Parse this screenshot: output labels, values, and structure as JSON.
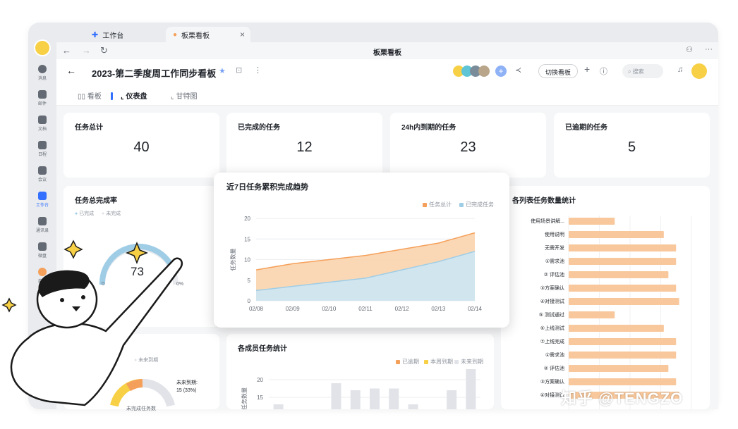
{
  "window": {
    "tabs": [
      {
        "label": "工作台"
      },
      {
        "label": "板栗看板"
      }
    ],
    "nav_title": "板栗看板"
  },
  "sidebar": {
    "items": [
      {
        "label": "消息"
      },
      {
        "label": "邮件"
      },
      {
        "label": "文档"
      },
      {
        "label": "日程"
      },
      {
        "label": "会议"
      },
      {
        "label": "工作台"
      },
      {
        "label": "通讯录"
      },
      {
        "label": "微盘"
      },
      {
        "label": "商店"
      }
    ]
  },
  "doc": {
    "title": "2023-第二季度周工作同步看板",
    "switch_label": "切换看板",
    "search_placeholder": "搜索",
    "view_tabs": [
      {
        "label": "看板"
      },
      {
        "label": "仪表盘"
      },
      {
        "label": "甘特图"
      }
    ]
  },
  "stats": [
    {
      "label": "任务总计",
      "value": "40"
    },
    {
      "label": "已完成的任务",
      "value": "12"
    },
    {
      "label": "24h内到期的任务",
      "value": "23"
    },
    {
      "label": "已逾期的任务",
      "value": "5"
    }
  ],
  "completion_card": {
    "title": "任务总完成率",
    "legend": [
      "已完成",
      "未完成"
    ],
    "value": "73",
    "gauge_left": "0",
    "gauge_right": "0%"
  },
  "list_card": {
    "title": "各列表任务数量统计"
  },
  "member_card": {
    "title": "各成员任务统计",
    "legend": [
      "已逾期",
      "本周到期",
      "未来到期"
    ]
  },
  "pie_card": {
    "legend_label": "未来到期",
    "slice_label_line1": "未来到期:",
    "slice_label_line2": "15 (33%)",
    "center_label": "未完成任务数"
  },
  "colors": {
    "accent": "#3370ff",
    "total": "#f5a05a",
    "done": "#9fcde6",
    "overdue": "#f5a05a",
    "week": "#f7d046",
    "future": "#e1e3e8"
  },
  "watermark": "知乎 @TENGZO",
  "chart_data": [
    {
      "type": "area",
      "title": "近7日任务累积完成趋势",
      "ylabel": "任务数量",
      "xlabel": "",
      "x": [
        "02/08",
        "02/09",
        "02/10",
        "02/11",
        "02/12",
        "02/13",
        "02/14"
      ],
      "ylim": [
        0,
        20
      ],
      "yticks": [
        0,
        5,
        10,
        15,
        20
      ],
      "grid": true,
      "legend": "top-right",
      "series": [
        {
          "name": "任务总计",
          "values": [
            7.5,
            9,
            10,
            11,
            12.5,
            14,
            16.5
          ]
        },
        {
          "name": "已完成任务",
          "values": [
            2.5,
            3.5,
            4.5,
            5.5,
            7.5,
            9.5,
            12
          ]
        }
      ]
    },
    {
      "type": "bar",
      "orientation": "horizontal",
      "title": "各列表任务数量统计",
      "categories": [
        "使用场景讲解...",
        "使用说明",
        "无需开发",
        "①需求池",
        "② 评估池",
        "③方案确认",
        "④对接测试",
        "⑤ 测试通过",
        "⑥上线测试",
        "⑦上线完成",
        "①需求池",
        "② 评估池",
        "③方案确认",
        "④对接测试"
      ],
      "values": [
        3,
        6.2,
        7,
        7,
        6.5,
        7,
        7.2,
        3,
        6.2,
        7,
        7,
        6.5,
        7,
        7.2
      ],
      "xlim": [
        0,
        8
      ]
    },
    {
      "type": "bar",
      "title": "各成员任务统计",
      "ylabel": "任务数量",
      "yticks": [
        10,
        15,
        20
      ],
      "ylim": [
        5,
        22
      ],
      "legend": "top-right",
      "series": [
        {
          "name": "已逾期",
          "values": [
            0,
            0,
            0,
            0,
            0,
            0,
            0,
            0,
            0,
            0,
            0
          ]
        },
        {
          "name": "本周到期",
          "values": [
            0,
            0,
            0,
            0,
            2,
            0.5,
            0.5,
            0,
            0,
            0,
            2
          ]
        },
        {
          "name": "未来到期",
          "values": [
            8,
            6,
            6,
            14,
            10,
            12,
            12,
            8,
            6,
            12,
            16
          ]
        }
      ]
    }
  ]
}
